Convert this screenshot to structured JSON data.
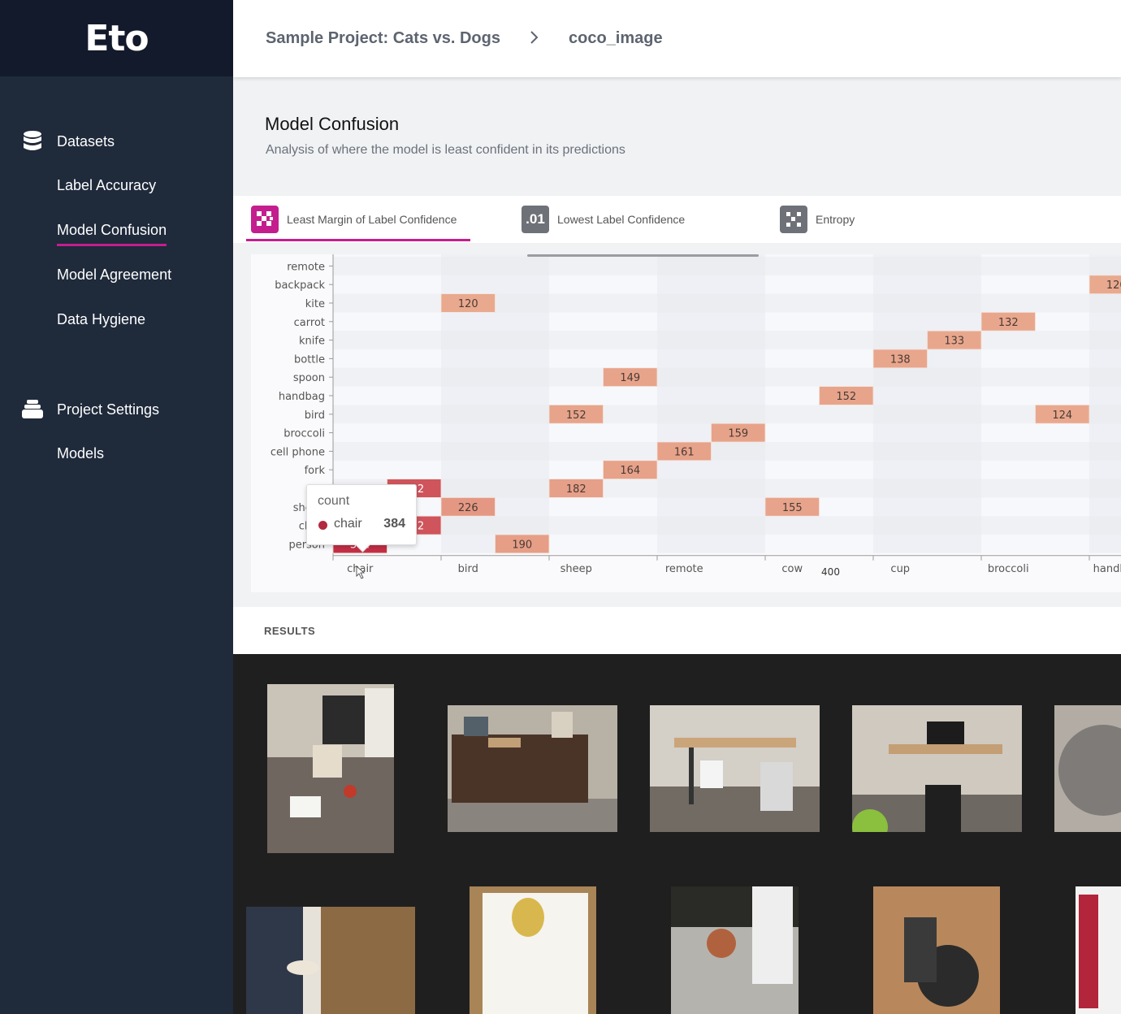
{
  "app": {
    "logo": "Eto"
  },
  "sidebar": {
    "datasets_label": "Datasets",
    "items": [
      {
        "label": "Label Accuracy"
      },
      {
        "label": "Model Confusion"
      },
      {
        "label": "Model Agreement"
      },
      {
        "label": "Data Hygiene"
      }
    ],
    "settings_label": "Project Settings",
    "settings_items": [
      {
        "label": "Models"
      }
    ]
  },
  "breadcrumb": {
    "project": "Sample Project: Cats vs. Dogs",
    "separator": ">",
    "dataset": "coco_image"
  },
  "section": {
    "title": "Model Confusion",
    "subtitle": "Analysis of where the model is least confident in its predictions"
  },
  "tabs": [
    {
      "label": "Least Margin of Label Confidence",
      "icon": "checker-icon",
      "color": "#c41e8e"
    },
    {
      "label": "Lowest Label Confidence",
      "icon_text": ".01",
      "color": "#6e7178"
    },
    {
      "label": "Entropy",
      "icon": "dice-icon",
      "color": "#6e7178"
    }
  ],
  "chart_data": {
    "type": "heatmap",
    "y_categories": [
      "remote",
      "backpack",
      "kite",
      "carrot",
      "knife",
      "bottle",
      "spoon",
      "handbag",
      "bird",
      "broccoli",
      "cell phone",
      "fork",
      "cup",
      "sheep",
      "chair",
      "person"
    ],
    "x_ticks": [
      "chair",
      "bird",
      "sheep",
      "remote",
      "cow",
      "cup",
      "broccoli",
      "handbag"
    ],
    "cells": [
      {
        "x": "chair",
        "y": "person",
        "value": 384
      },
      {
        "x": "chair",
        "y": "chair",
        "value": 302
      },
      {
        "x": "chair",
        "y": "cup",
        "value": 302
      },
      {
        "x": "bird",
        "y": "sheep",
        "value": 226
      },
      {
        "x": "bird",
        "y": "kite",
        "value": 120
      },
      {
        "x": "bird",
        "y": "person",
        "value": 190
      },
      {
        "x": "sheep",
        "y": "bird",
        "value": 152
      },
      {
        "x": "sheep",
        "y": "cup",
        "value": 182
      },
      {
        "x": "sheep",
        "y": "spoon",
        "value": 149
      },
      {
        "x": "sheep",
        "y": "fork",
        "value": 164
      },
      {
        "x": "remote",
        "y": "cell phone",
        "value": 161
      },
      {
        "x": "remote",
        "y": "broccoli",
        "value": 159
      },
      {
        "x": "cow",
        "y": "sheep",
        "value": 155
      },
      {
        "x": "cow",
        "y": "handbag",
        "value": 152
      },
      {
        "x": "cup",
        "y": "bottle",
        "value": 138
      },
      {
        "x": "cup",
        "y": "knife",
        "value": 133
      },
      {
        "x": "broccoli",
        "y": "carrot",
        "value": 132
      },
      {
        "x": "broccoli",
        "y": "bird",
        "value": 124
      },
      {
        "x": "handbag",
        "y": "backpack",
        "value": 120
      }
    ],
    "extra_label": "400",
    "tooltip": {
      "title": "count",
      "series": "chair",
      "value": "384"
    },
    "colors": {
      "low": "#e9a98e",
      "high": "#c42e46"
    }
  },
  "results": {
    "label": "RESULTS",
    "thumbnails": [
      {
        "name": "office-floor-clutter"
      },
      {
        "name": "cabinet-desk"
      },
      {
        "name": "standing-desk-chair"
      },
      {
        "name": "desk-monitor"
      },
      {
        "name": "grey-armchair"
      },
      {
        "name": "door-stool"
      },
      {
        "name": "police-card"
      },
      {
        "name": "potted-succulent"
      },
      {
        "name": "bike-parts-box"
      },
      {
        "name": "red-item"
      }
    ]
  }
}
